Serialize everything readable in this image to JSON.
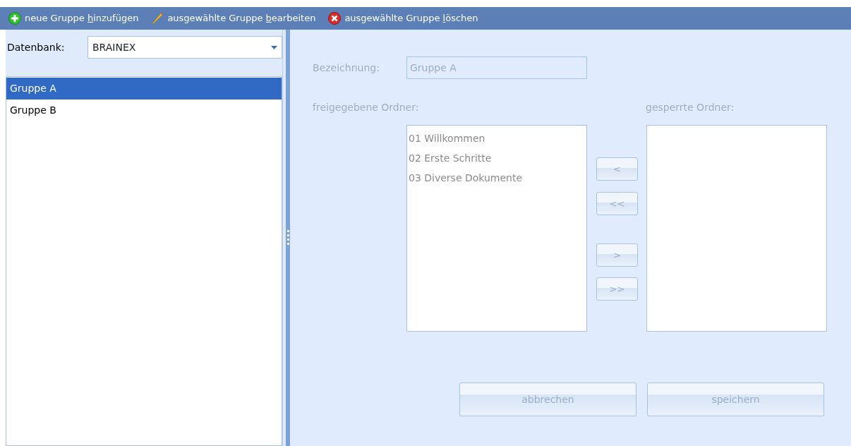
{
  "toolbar": [
    {
      "kind": "add",
      "label_parts": [
        "neue Gruppe ",
        "h",
        "inzufügen"
      ]
    },
    {
      "kind": "edit",
      "label_parts": [
        "ausgewählte Gruppe ",
        "b",
        "earbeiten"
      ]
    },
    {
      "kind": "delete",
      "label_parts": [
        "ausgewählte Gruppe ",
        "l",
        "öschen"
      ]
    }
  ],
  "sidebar": {
    "database_label": "Datenbank:",
    "database_value": "BRAINEX",
    "groups": [
      {
        "label": "Gruppe A",
        "selected": true
      },
      {
        "label": "Gruppe B",
        "selected": false
      }
    ]
  },
  "editor": {
    "disabled": true,
    "name_label": "Bezeichnung:",
    "name_value": "Gruppe A",
    "released_label": "freigegebene Ordner:",
    "locked_label": "gesperrte Ordner:",
    "released_folders": [
      "01 Willkommen",
      "02 Erste Schritte",
      "03 Diverse Dokumente"
    ],
    "move_buttons": [
      {
        "label": "<",
        "kind": "unlock"
      },
      {
        "label": "<<",
        "kind": "unlock"
      },
      {
        "label": ">",
        "kind": "lock"
      },
      {
        "label": ">>",
        "kind": "lock"
      }
    ],
    "buttons": [
      "abbrechen",
      "speichern"
    ]
  }
}
